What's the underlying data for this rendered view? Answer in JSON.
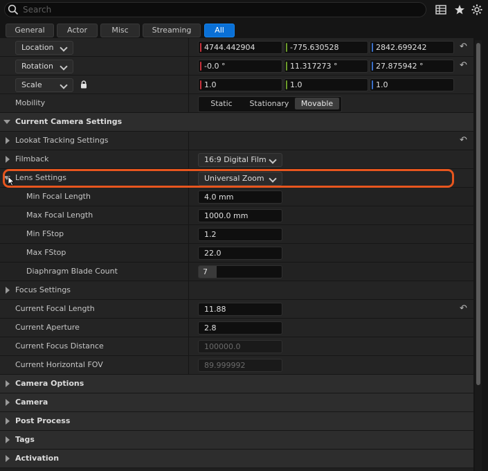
{
  "search": {
    "placeholder": "Search"
  },
  "toolbar": {
    "icons": [
      "table-icon",
      "star-icon",
      "gear-icon"
    ]
  },
  "filters": {
    "tabs": [
      "General",
      "Actor",
      "Misc",
      "Streaming",
      "All"
    ],
    "active": "All"
  },
  "transform": {
    "location": {
      "label": "Location",
      "x": "4744.442904",
      "y": "-775.630528",
      "z": "2842.699242"
    },
    "rotation": {
      "label": "Rotation",
      "x": "-0.0 °",
      "y": "11.317273 °",
      "z": "27.875942 °"
    },
    "scale": {
      "label": "Scale",
      "x": "1.0",
      "y": "1.0",
      "z": "1.0"
    },
    "mobility": {
      "label": "Mobility",
      "options": [
        "Static",
        "Stationary",
        "Movable"
      ],
      "selected": "Movable"
    }
  },
  "camera_settings": {
    "header": "Current Camera Settings",
    "lookat": "Lookat Tracking Settings",
    "filmback": {
      "label": "Filmback",
      "value": "16:9 Digital Film"
    },
    "lens": {
      "label": "Lens Settings",
      "value": "Universal Zoom"
    },
    "lens_fields": [
      {
        "label": "Min Focal Length",
        "value": "4.0 mm"
      },
      {
        "label": "Max Focal Length",
        "value": "1000.0 mm"
      },
      {
        "label": "Min FStop",
        "value": "1.2"
      },
      {
        "label": "Max FStop",
        "value": "22.0"
      },
      {
        "label": "Diaphragm Blade Count",
        "value": "7"
      }
    ],
    "focus": "Focus Settings",
    "current_focal_length": {
      "label": "Current Focal Length",
      "value": "11.88"
    },
    "current_aperture": {
      "label": "Current Aperture",
      "value": "2.8"
    },
    "current_focus_distance": {
      "label": "Current Focus Distance",
      "value": "100000.0"
    },
    "current_hfov": {
      "label": "Current Horizontal FOV",
      "value": "89.999992"
    }
  },
  "sections": [
    "Camera Options",
    "Camera",
    "Post Process",
    "Tags",
    "Activation"
  ],
  "colors": {
    "accent": "#0a70d6",
    "highlight": "#e8561e",
    "x_axis": "#c8323c",
    "y_axis": "#6b9a2a",
    "z_axis": "#3a6fc8"
  }
}
